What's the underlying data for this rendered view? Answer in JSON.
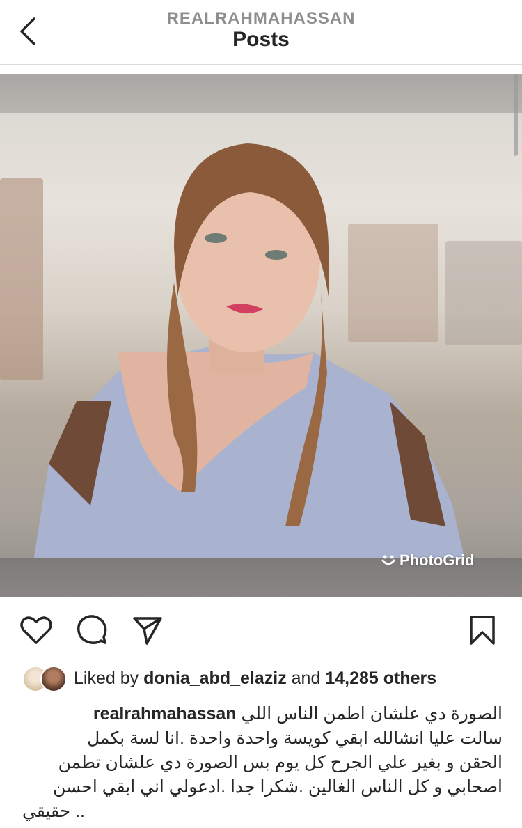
{
  "header": {
    "username": "REALRAHMAHASSAN",
    "title": "Posts"
  },
  "post": {
    "watermark": "PhotoGrid",
    "likes": {
      "prefix": "Liked by",
      "user": "donia_abd_elaziz",
      "middle": "and",
      "count": "14,285 others"
    },
    "caption": {
      "username": "realrahmahassan",
      "lines": [
        "الصورة دي علشان اطمن الناس اللي",
        "سالت عليا انشالله ابقي كويسة واحدة واحدة .انا لسة بكمل",
        "الحقن و بغير علي الجرح كل يوم بس الصورة دي علشان تطمن",
        "اصحابي و كل الناس الغالين .شكرا جدا .ادعولي اني ابقي احسن",
        "حقيقي .."
      ]
    }
  },
  "icons": [
    "back-arrow-icon",
    "heart-icon",
    "comment-icon",
    "share-icon",
    "bookmark-icon"
  ],
  "colors": {
    "text": "#262626",
    "muted": "#8e8e8e",
    "divider": "#dbdbdb"
  }
}
